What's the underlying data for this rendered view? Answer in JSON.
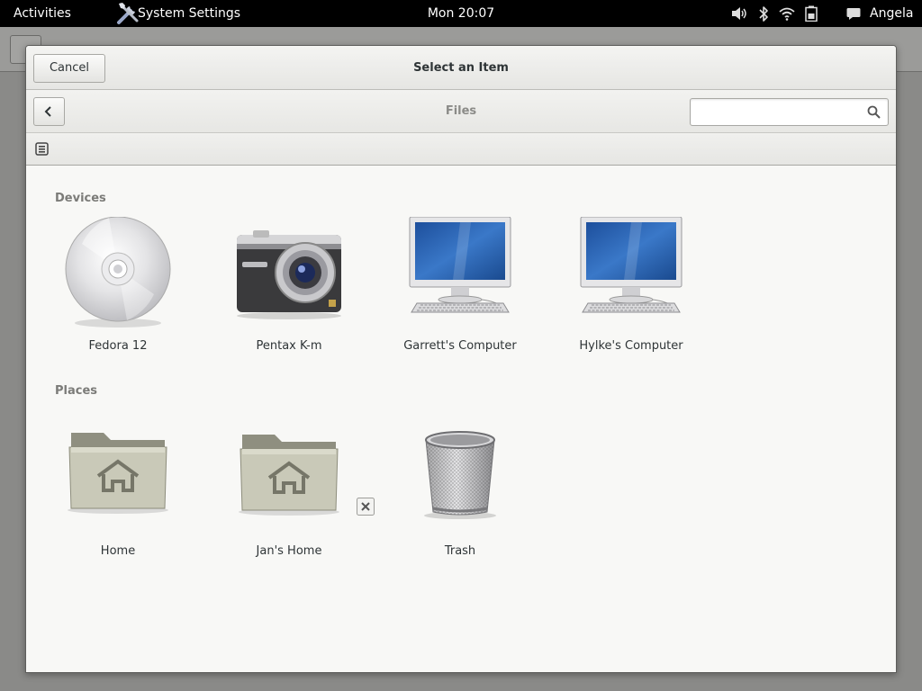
{
  "top_bar": {
    "activities": "Activities",
    "app_menu": "System Settings",
    "clock": "Mon 20:07",
    "user": "Angela",
    "status_icons": [
      "volume-icon",
      "bluetooth-icon",
      "wifi-icon",
      "battery-icon",
      "chat-icon"
    ]
  },
  "dialog": {
    "title": "Select an Item",
    "cancel_label": "Cancel",
    "location": "Files",
    "search": {
      "value": "",
      "placeholder": ""
    },
    "view_icon": "list-view-icon"
  },
  "sections": [
    {
      "label": "Devices",
      "items": [
        {
          "label": "Fedora 12",
          "icon": "disc-icon"
        },
        {
          "label": "Pentax K-m",
          "icon": "camera-icon"
        },
        {
          "label": "Garrett's Computer",
          "icon": "computer-icon"
        },
        {
          "label": "Hylke's Computer",
          "icon": "computer-icon"
        }
      ]
    },
    {
      "label": "Places",
      "items": [
        {
          "label": "Home",
          "icon": "home-folder-icon"
        },
        {
          "label": "Jan's Home",
          "icon": "home-folder-icon",
          "removable": true
        },
        {
          "label": "Trash",
          "icon": "trash-icon"
        }
      ]
    }
  ]
}
